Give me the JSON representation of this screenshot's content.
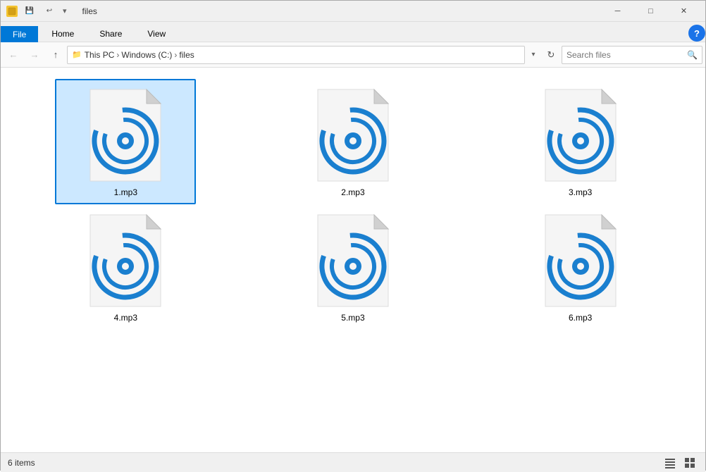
{
  "window": {
    "title": "files",
    "icon_label": "folder-icon"
  },
  "titlebar": {
    "quick_access": [
      "save-icon",
      "undo-icon"
    ],
    "controls": {
      "minimize": "─",
      "maximize": "□",
      "close": "✕"
    }
  },
  "ribbon": {
    "tabs": [
      "File",
      "Home",
      "Share",
      "View"
    ],
    "active_tab": "Home"
  },
  "navbar": {
    "back_tooltip": "Back",
    "forward_tooltip": "Forward",
    "up_tooltip": "Up",
    "path": [
      {
        "label": "This PC",
        "sep": "›"
      },
      {
        "label": "Windows (C:)",
        "sep": "›"
      },
      {
        "label": "files",
        "sep": ""
      }
    ],
    "search_placeholder": "Search files",
    "search_label": "Search"
  },
  "files": [
    {
      "name": "1.mp3",
      "selected": true
    },
    {
      "name": "2.mp3",
      "selected": false
    },
    {
      "name": "3.mp3",
      "selected": false
    },
    {
      "name": "4.mp3",
      "selected": false
    },
    {
      "name": "5.mp3",
      "selected": false
    },
    {
      "name": "6.mp3",
      "selected": false
    }
  ],
  "statusbar": {
    "count_label": "6 items"
  }
}
